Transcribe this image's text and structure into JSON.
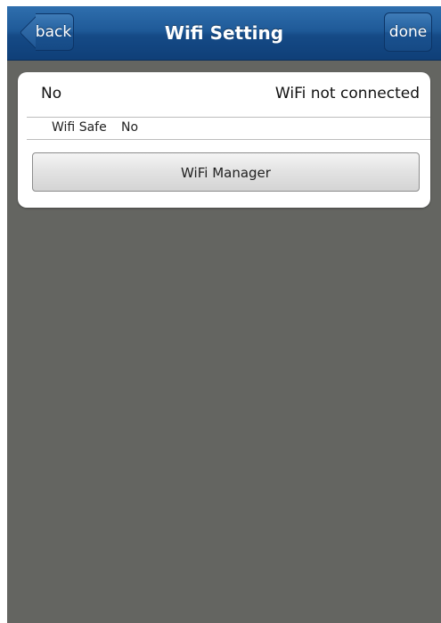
{
  "navbar": {
    "title": "Wifi Setting",
    "back_label": "back",
    "done_label": "done"
  },
  "status": {
    "left_value": "No",
    "right_value": "WiFi not connected"
  },
  "wifi_safe": {
    "label": "Wifi Safe",
    "value": "No"
  },
  "manager_button": {
    "label": "WiFi Manager"
  },
  "colors": {
    "navbar": "#1f5a98",
    "background": "#646561",
    "card": "#ffffff"
  }
}
